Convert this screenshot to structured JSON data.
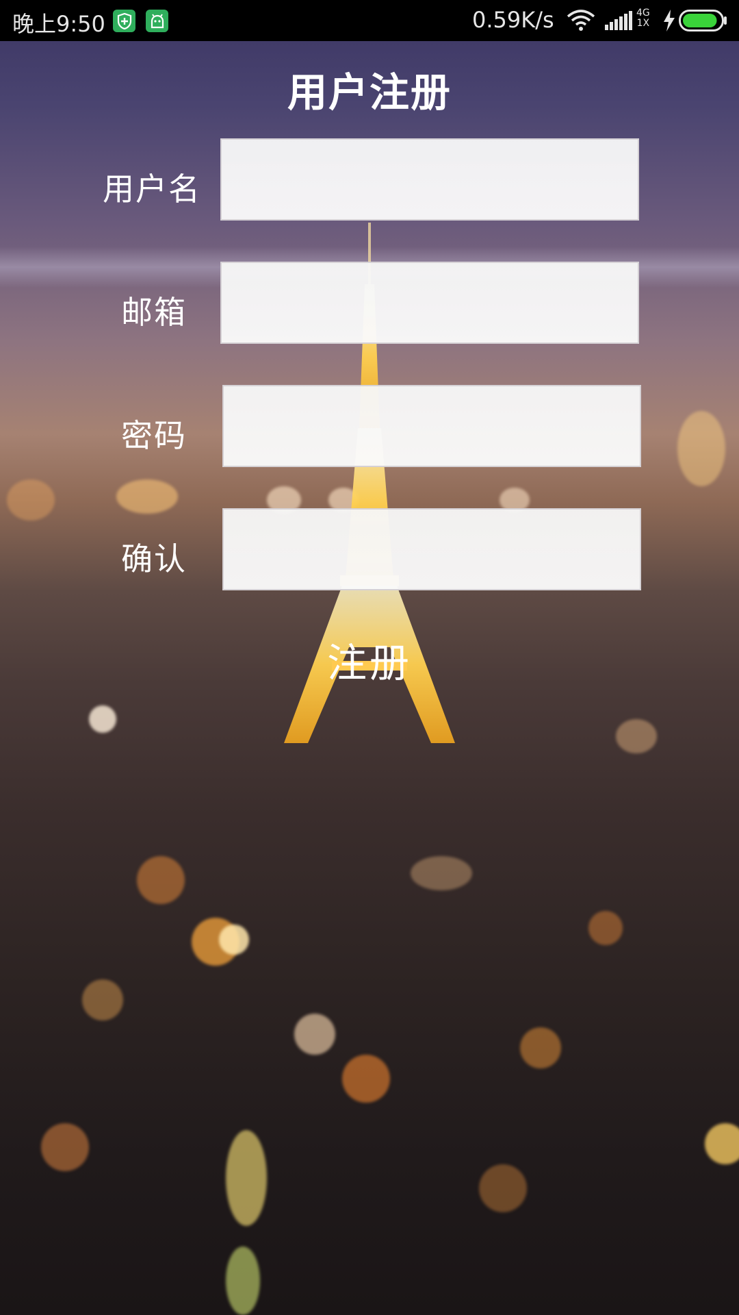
{
  "status_bar": {
    "time": "晚上9:50",
    "network_speed": "0.59K/s",
    "network_type_top": "4G",
    "network_type_bottom": "1X",
    "icons": [
      "shield-app-icon",
      "android-app-icon",
      "wifi-icon",
      "signal-icon",
      "charging-icon",
      "battery-icon"
    ],
    "battery_level": 0.9,
    "battery_color": "#3ad33a",
    "app_icon_color": "#2fae5c"
  },
  "form": {
    "title": "用户注册",
    "fields": [
      {
        "label": "用户名",
        "value": "",
        "placeholder": ""
      },
      {
        "label": "邮箱",
        "value": "",
        "placeholder": ""
      },
      {
        "label": "密码",
        "value": "",
        "placeholder": ""
      },
      {
        "label": "确认",
        "value": "",
        "placeholder": ""
      }
    ],
    "submit_label": "注册"
  }
}
